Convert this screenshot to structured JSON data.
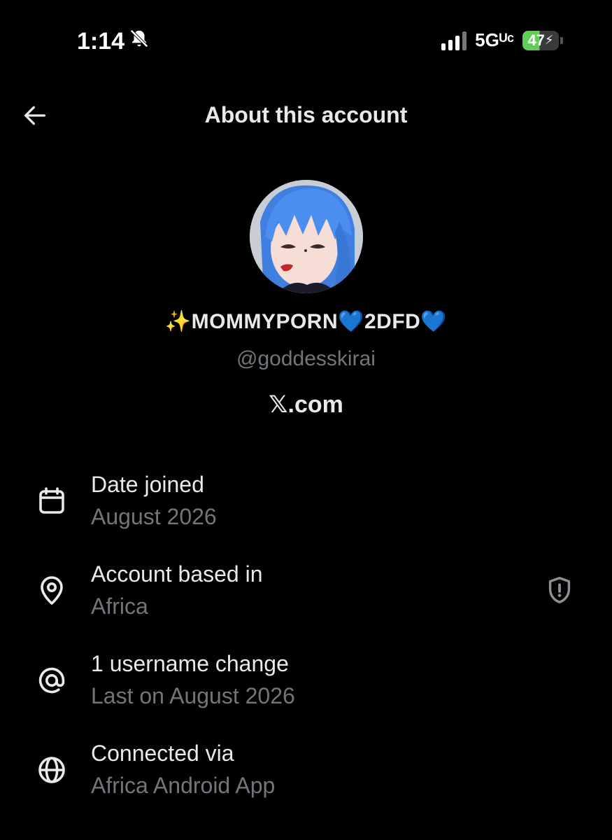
{
  "status_bar": {
    "time": "1:14",
    "network": "5Gᵁᶜ",
    "battery": "47"
  },
  "header": {
    "title": "About this account"
  },
  "profile": {
    "display_name": "✨MOMMYPORN💙2DFD💙",
    "handle": "@goddesskirai",
    "site": "𝕏.com"
  },
  "info": [
    {
      "label": "Date joined",
      "value": "August 2026",
      "icon": "calendar-icon"
    },
    {
      "label": "Account based in",
      "value": "Africa",
      "icon": "location-pin-icon"
    },
    {
      "label": "1 username change",
      "value": "Last on August 2026",
      "icon": "at-sign-icon"
    },
    {
      "label": "Connected via",
      "value": "Africa Android App",
      "icon": "globe-icon"
    }
  ],
  "colors": {
    "background": "#000000",
    "primary_text": "#e7e9ea",
    "secondary_text": "#71767b",
    "battery_green": "#5fcf5a"
  }
}
